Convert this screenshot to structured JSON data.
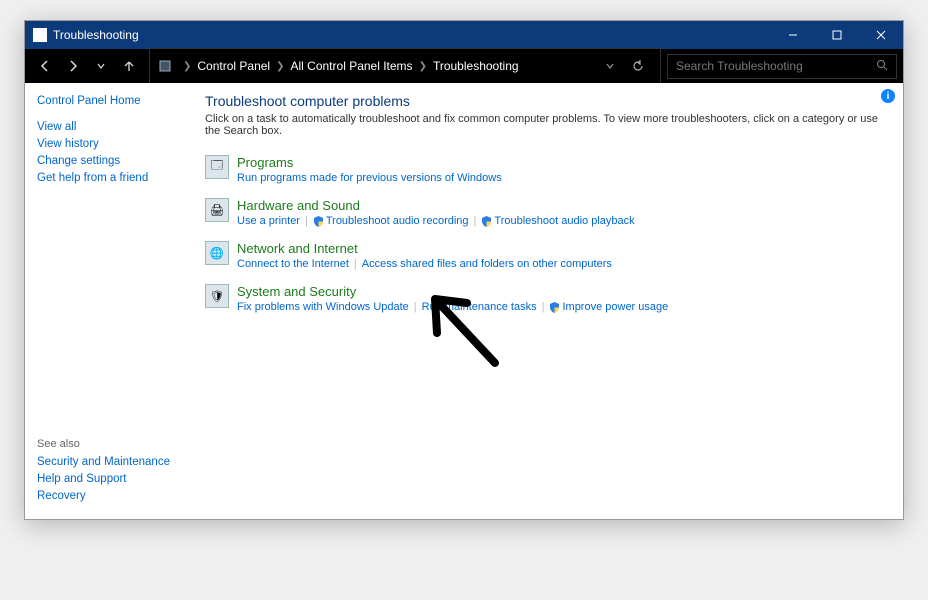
{
  "titlebar": {
    "title": "Troubleshooting"
  },
  "breadcrumb": {
    "parts": [
      "Control Panel",
      "All Control Panel Items",
      "Troubleshooting"
    ]
  },
  "search": {
    "placeholder": "Search Troubleshooting"
  },
  "sidebar": {
    "heading": "Control Panel Home",
    "items": [
      "View all",
      "View history",
      "Change settings",
      "Get help from a friend"
    ],
    "seealso_label": "See also",
    "seealso": [
      "Security and Maintenance",
      "Help and Support",
      "Recovery"
    ]
  },
  "main": {
    "heading": "Troubleshoot computer problems",
    "description": "Click on a task to automatically troubleshoot and fix common computer problems. To view more troubleshooters, click on a category or use the Search box.",
    "categories": [
      {
        "title": "Programs",
        "links": [
          {
            "label": "Run programs made for previous versions of Windows",
            "shield": false
          }
        ]
      },
      {
        "title": "Hardware and Sound",
        "links": [
          {
            "label": "Use a printer",
            "shield": false
          },
          {
            "label": "Troubleshoot audio recording",
            "shield": true
          },
          {
            "label": "Troubleshoot audio playback",
            "shield": true
          }
        ]
      },
      {
        "title": "Network and Internet",
        "links": [
          {
            "label": "Connect to the Internet",
            "shield": false
          },
          {
            "label": "Access shared files and folders on other computers",
            "shield": false
          }
        ]
      },
      {
        "title": "System and Security",
        "links": [
          {
            "label": "Fix problems with Windows Update",
            "shield": false
          },
          {
            "label": "Run maintenance tasks",
            "shield": false
          },
          {
            "label": "Improve power usage",
            "shield": true
          }
        ]
      }
    ]
  }
}
